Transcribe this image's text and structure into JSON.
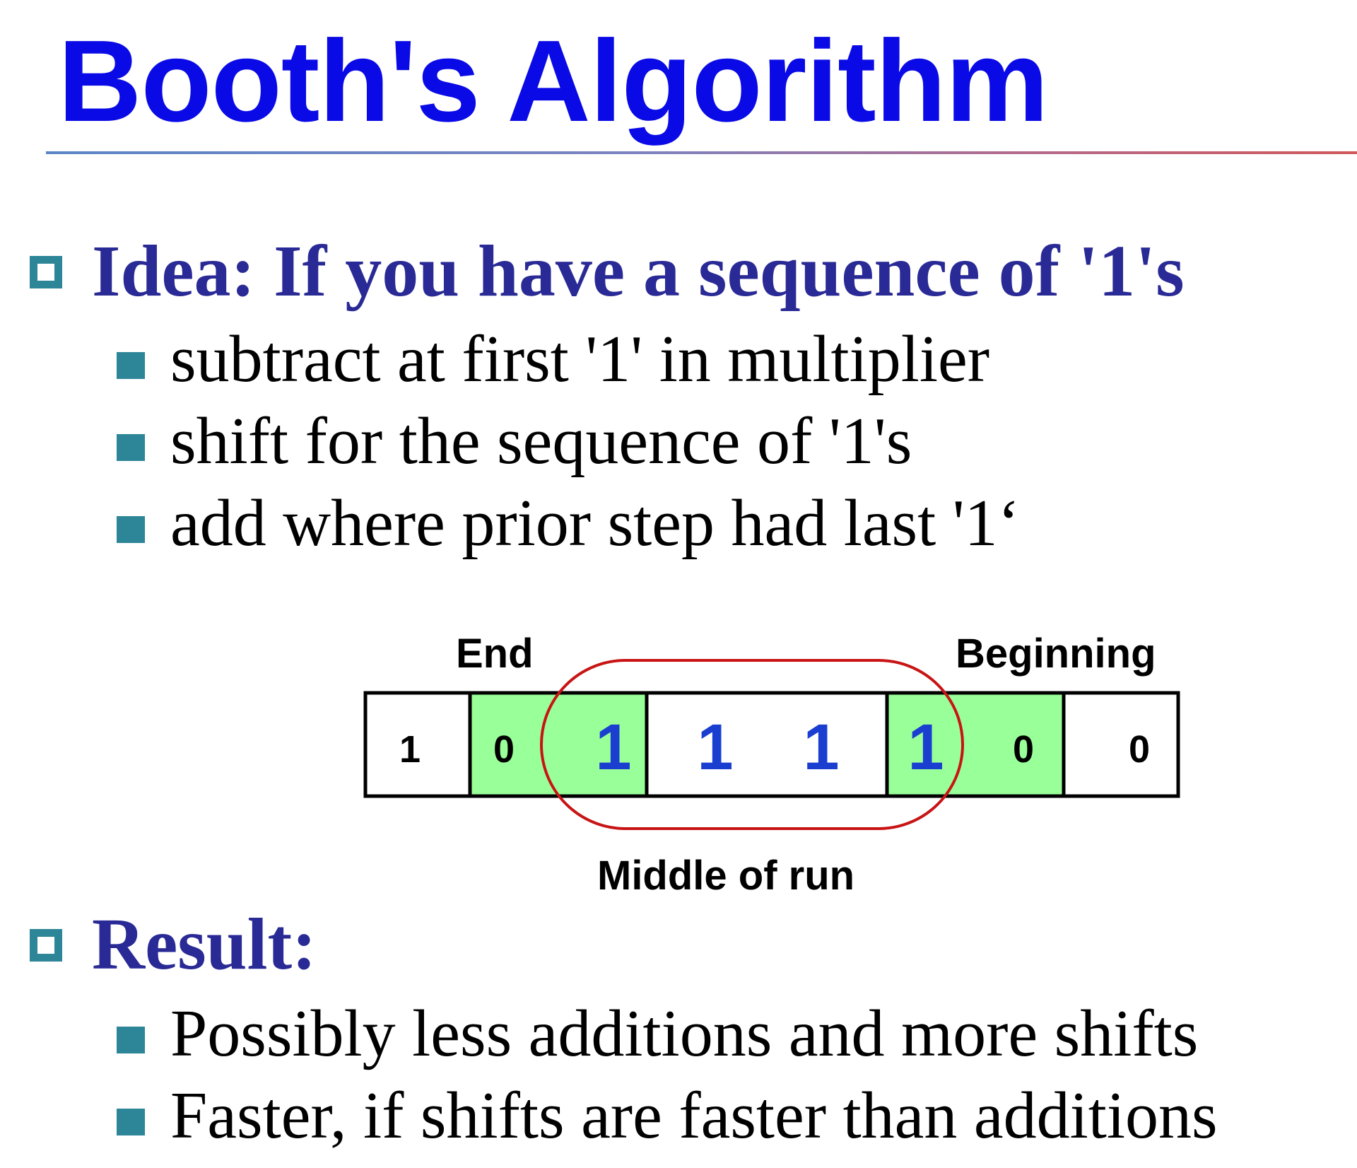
{
  "slide": {
    "title": "Booth's Algorithm",
    "idea": {
      "heading": "Idea: If you have a sequence of '1's",
      "points": [
        "subtract at first '1' in multiplier",
        "shift for the sequence of '1's",
        "add where prior step had last '1‘"
      ]
    },
    "diagram": {
      "label_end": "End",
      "label_beginning": "Beginning",
      "label_middle": "Middle of run",
      "bits": [
        "1",
        "0",
        "1",
        "1",
        "1",
        "1",
        "0",
        "0"
      ],
      "colors": {
        "highlight_fill": "#99ff99",
        "circle_stroke": "#c81414",
        "run_digit": "#1a3fd0",
        "plain_digit": "#000000"
      }
    },
    "result": {
      "heading": "Result:",
      "points": [
        "Possibly less additions and more shifts",
        "Faster, if shifts are faster than additions"
      ]
    }
  }
}
